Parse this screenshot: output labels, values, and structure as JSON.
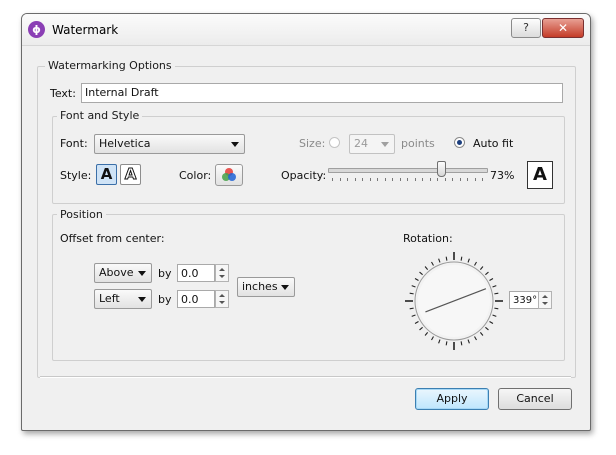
{
  "window": {
    "title": "Watermark",
    "help_glyph": "?",
    "close_glyph": "✕",
    "app_icon_glyph": "ϕ"
  },
  "options_group": {
    "label": "Watermarking Options",
    "text_label": "Text:",
    "text_value": "Internal Draft"
  },
  "font_style": {
    "label": "Font and Style",
    "font_label": "Font:",
    "font_value": "Helvetica",
    "size_label": "Size:",
    "size_value": "24",
    "points_label": "points",
    "autofit_label": "Auto fit",
    "size_mode_selected": "Auto fit",
    "style_label": "Style:",
    "style_options": [
      "A",
      "A"
    ],
    "style_selected_index": 0,
    "color_label": "Color:",
    "opacity_label": "Opacity:",
    "opacity_value": "73%",
    "opacity_fraction": 0.73,
    "preview_glyph": "A"
  },
  "position": {
    "label": "Position",
    "offset_label": "Offset from center:",
    "vertical_direction": "Above",
    "vertical_by_label": "by",
    "vertical_amount": "0.0",
    "horizontal_direction": "Left",
    "horizontal_by_label": "by",
    "horizontal_amount": "0.0",
    "units": "inches",
    "rotation_label": "Rotation:",
    "rotation_value": "339°",
    "rotation_degrees": 339
  },
  "buttons": {
    "apply": "Apply",
    "cancel": "Cancel"
  }
}
